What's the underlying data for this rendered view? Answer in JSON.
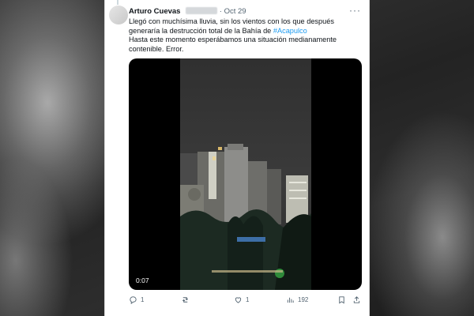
{
  "tweet": {
    "author_name": "Arturo Cuevas",
    "separator": "·",
    "date": "Oct 29",
    "more_label": "···",
    "text_line1": "Llegó con muchísima lluvia, sin los vientos con los que después generaría la destrucción total de la Bahía de ",
    "hashtag": "#Acapulco",
    "text_line2": "Hasta este momento esperábamos una situación medianamente contenible. Error."
  },
  "media": {
    "video_duration": "0:07"
  },
  "actions": {
    "replies": "1",
    "reposts": "",
    "likes": "1",
    "views": "192"
  }
}
